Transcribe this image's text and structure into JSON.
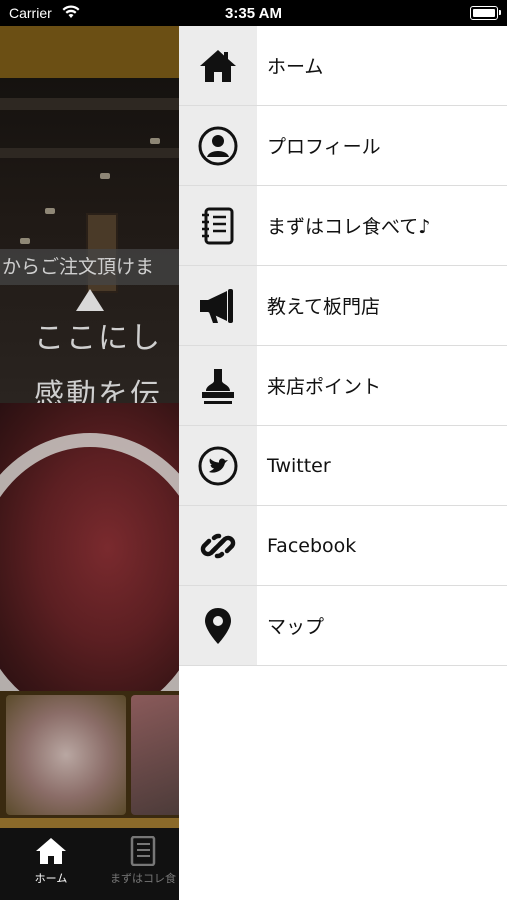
{
  "status_bar": {
    "carrier": "Carrier",
    "time": "3:35 AM"
  },
  "background": {
    "ticker_text": "からご注文頂けま",
    "hero_line1": "ここにし",
    "hero_line2": "感動を伝",
    "tabs": [
      {
        "label": "ホーム",
        "icon": "home-icon"
      },
      {
        "label": "まずはコレ食",
        "icon": "notebook-icon"
      }
    ]
  },
  "menu": {
    "items": [
      {
        "label": "ホーム",
        "icon": "home-icon"
      },
      {
        "label": "プロフィール",
        "icon": "profile-icon"
      },
      {
        "label": "まずはコレ食べて♪",
        "icon": "notebook-icon"
      },
      {
        "label": "教えて板門店",
        "icon": "megaphone-icon"
      },
      {
        "label": "来店ポイント",
        "icon": "stamp-icon"
      },
      {
        "label": "Twitter",
        "icon": "twitter-icon"
      },
      {
        "label": "Facebook",
        "icon": "link-icon"
      },
      {
        "label": "マップ",
        "icon": "map-pin-icon"
      }
    ]
  }
}
